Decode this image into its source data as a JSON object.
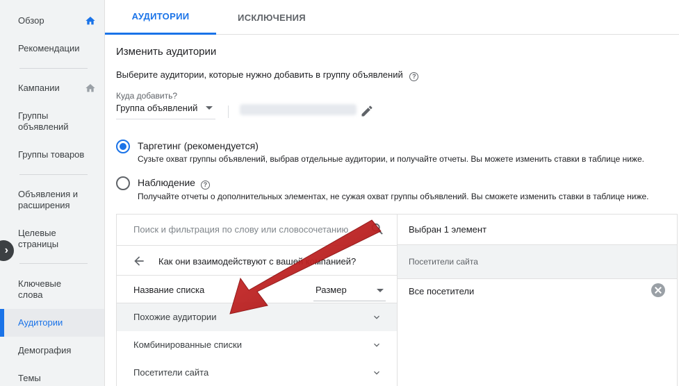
{
  "sidebar": {
    "items": [
      {
        "label": "Обзор",
        "icon": "home-icon",
        "icon_color": "#1a73e8"
      },
      {
        "label": "Рекомендации"
      },
      {
        "label": "Кампании",
        "icon": "home-icon",
        "icon_color": "#9aa0a6"
      },
      {
        "label": "Группы объявлений"
      },
      {
        "label": "Группы товаров"
      },
      {
        "label": "Объявления и расширения"
      },
      {
        "label": "Целевые страницы"
      },
      {
        "label": "Ключевые слова"
      },
      {
        "label": "Аудитории",
        "active": true
      },
      {
        "label": "Демография"
      },
      {
        "label": "Темы"
      }
    ],
    "collapse_icon": "chevron-right-icon"
  },
  "tabs": [
    {
      "label": "АУДИТОРИИ",
      "active": true
    },
    {
      "label": "ИСКЛЮЧЕНИЯ"
    }
  ],
  "page": {
    "title": "Изменить аудитории",
    "subtitle": "Выберите аудитории, которые нужно добавить в группу объявлений"
  },
  "target": {
    "label": "Куда добавить?",
    "value": "Группа объявлений"
  },
  "options": [
    {
      "title": "Таргетинг (рекомендуется)",
      "desc": "Сузьте охват группы объявлений, выбрав отдельные аудитории, и получайте отчеты. Вы можете изменить ставки в таблице ниже.",
      "selected": true
    },
    {
      "title": "Наблюдение",
      "desc": "Получайте отчеты о дополнительных элементах, не сужая охват группы объявлений. Вы сможете изменить ставки в таблице ниже.",
      "selected": false
    }
  ],
  "browser": {
    "search_placeholder": "Поиск и фильтрация по слову или словосочетанию",
    "back_label": "Как они взаимодействуют с вашей компанией?",
    "col_name": "Название списка",
    "col_size": "Размер",
    "rows": [
      {
        "label": "Похожие аудитории"
      },
      {
        "label": "Комбинированные списки"
      },
      {
        "label": "Посетители сайта"
      }
    ]
  },
  "selected": {
    "header": "Выбран 1 элемент",
    "group": "Посетители сайта",
    "items": [
      {
        "label": "Все посетители"
      }
    ]
  },
  "colors": {
    "accent": "#1a73e8",
    "arrow": "#c62828"
  }
}
